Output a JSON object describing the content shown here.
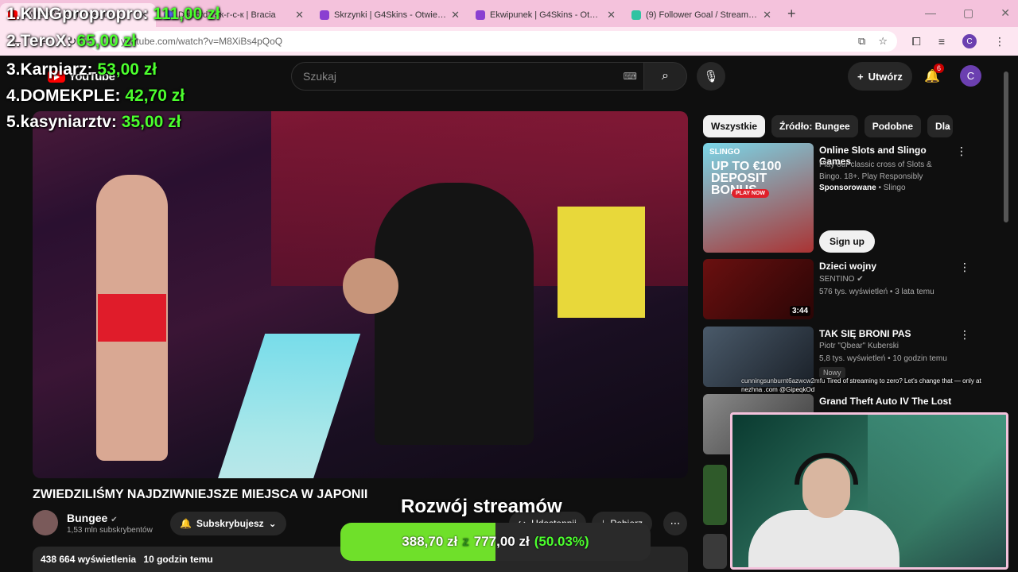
{
  "browser": {
    "tabs": [
      {
        "title": "ZWIEDZILIŚMY NAJDZ...",
        "color": "#ff0000",
        "active": true
      },
      {
        "title": "Discord | #к-г-с-к | Bracia",
        "color": "#5865f2",
        "active": false
      },
      {
        "title": "Skrzynki | G4Skins - Otwieraj sk",
        "color": "#8a3fd1",
        "active": false
      },
      {
        "title": "Ekwipunek | G4Skins - Otwieraj",
        "color": "#8a3fd1",
        "active": false
      },
      {
        "title": "(9) Follower Goal / Streamlabs",
        "color": "#31c3a2",
        "active": false
      }
    ],
    "url": "youtube.com/watch?v=M8XiBs4pQoQ",
    "profile_initial": "C"
  },
  "youtube": {
    "logo_text": "YouTube",
    "search_placeholder": "Szukaj",
    "create_label": "Utwórz",
    "notif_count": "6",
    "account_initial": "C"
  },
  "donors": [
    {
      "label": "1.KINGpropropro:",
      "amount": "111,00 zł"
    },
    {
      "label": "2.TeroX:",
      "amount": "65,00 zł"
    },
    {
      "label": "3.Karpiarz:",
      "amount": "53,00 zł"
    },
    {
      "label": "4.DOMEKPLE:",
      "amount": "42,70 zł"
    },
    {
      "label": "5.kasyniarztv:",
      "amount": "35,00 zł"
    }
  ],
  "video": {
    "title": "ZWIEDZILIŚMY NAJDZIWNIEJSZE MIEJSCA W JAPONII",
    "channel": "Bungee",
    "subs": "1,53 mln subskrybentów",
    "subscribe_label": "Subskrybujesz",
    "share_label": "Udostępnij",
    "download_label": "Pobierz",
    "views": "438 664 wyświetlenia",
    "age": "10 godzin temu"
  },
  "goal": {
    "title": "Rozwój streamów",
    "current": "388,70 zł",
    "separator": "z",
    "target": "777,00 zł",
    "percent": "(50.03%)",
    "fraction": 0.5003
  },
  "sidebar": {
    "chips": [
      "Wszystkie",
      "Źródło: Bungee",
      "Podobne",
      "Dla"
    ],
    "ad": {
      "brand": "SLINGO",
      "headline": "UP TO €100 DEPOSIT BONUS",
      "cta": "PLAY NOW",
      "title": "Online Slots and Slingo Games",
      "desc": "Play our classic cross of Slots & Bingo. 18+. Play Responsibly",
      "sponsored": "Sponsorowane",
      "advertiser": "Slingo",
      "signup": "Sign up"
    },
    "recs": [
      {
        "title": "Dzieci wojny",
        "channel": "SENTINO",
        "meta": "576 tys. wyświetleń • 3 lata temu",
        "duration": "3:44",
        "color": "#5a1010"
      },
      {
        "title": "TAK SIĘ BRONI PAS",
        "channel": "Piotr \"Qbear\" Kuberski",
        "meta": "5,8 tys. wyświetleń • 10 godzin temu",
        "badge": "Nowy",
        "color": "#3a4a5a"
      },
      {
        "title": "Grand Theft Auto IV The Lost",
        "color": "#6a6a6a"
      }
    ]
  },
  "chat": {
    "user": "cunningsunburnt6azwcw2mfu",
    "message": "Tired of streaming to zero? Let's change that — only at nezhna .com @GipeqkOd"
  }
}
